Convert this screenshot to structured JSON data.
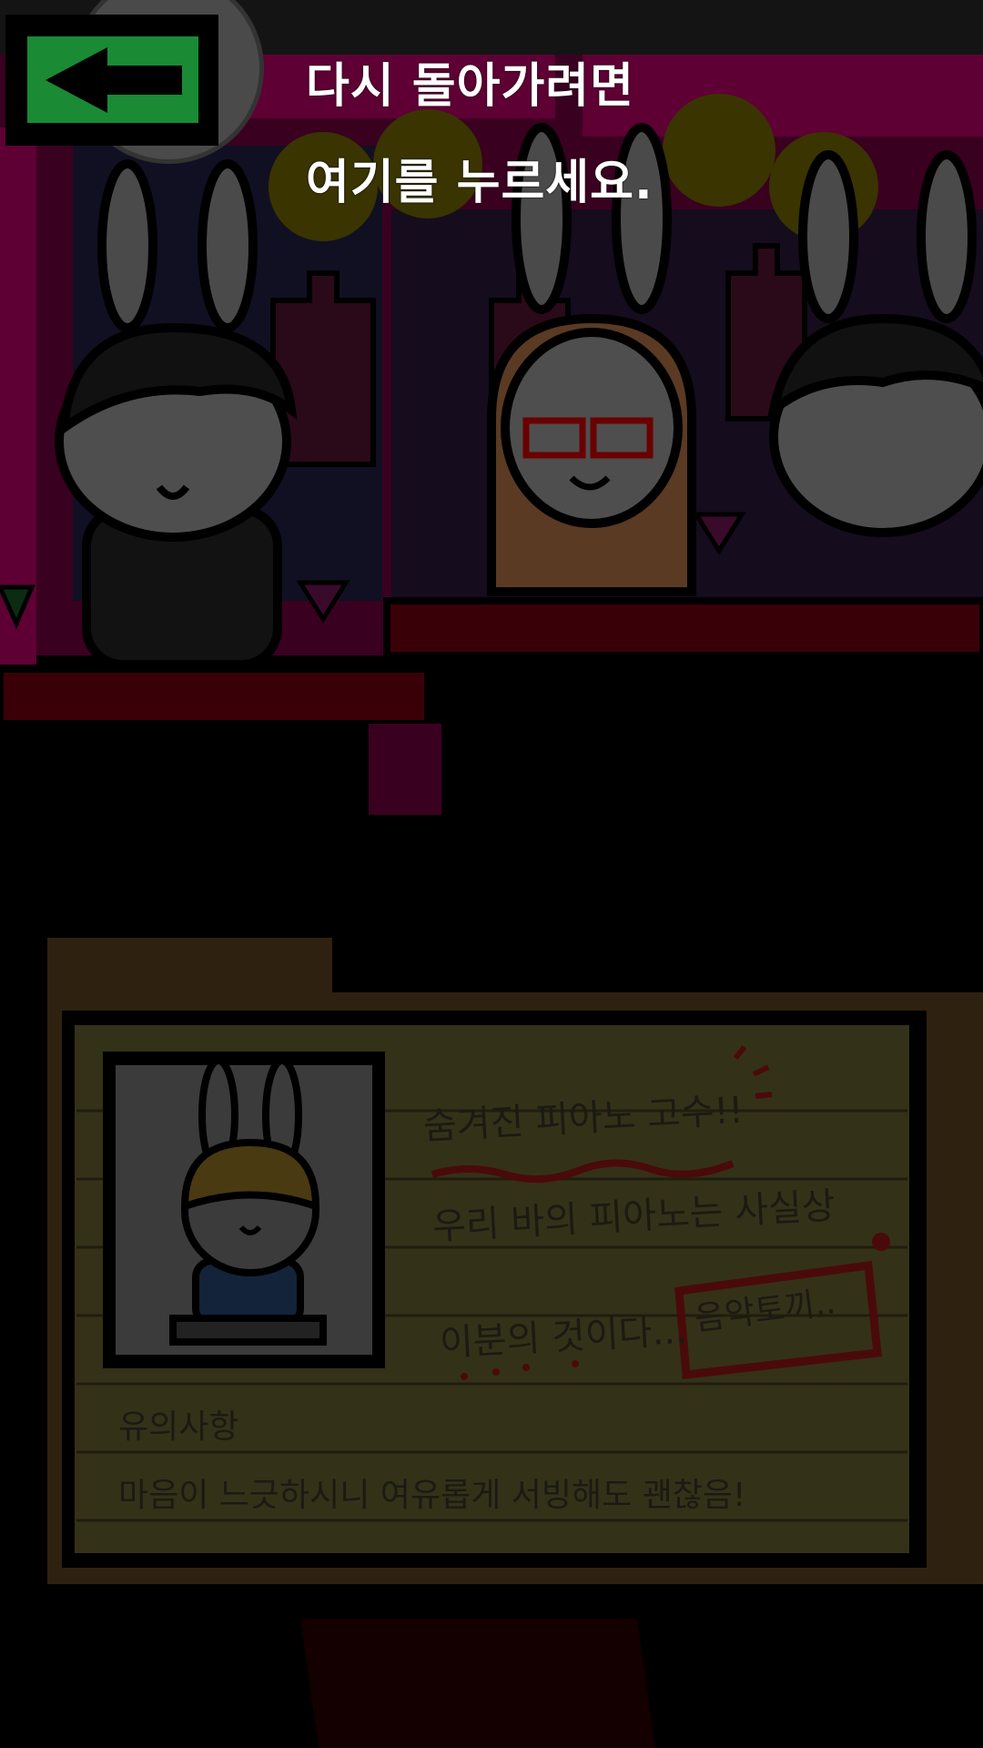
{
  "hint": {
    "line1": "다시 돌아가려면",
    "line2": "여기를 누르세요."
  },
  "back_button": {
    "icon": "arrow-left-icon",
    "color": "#1a8a34"
  },
  "card": {
    "title": "숨겨진 피아노 고수!!",
    "desc_line1": "우리 바의 피아노는 사실상",
    "desc_line2": "이분의 것이다...",
    "stamp": "음악토끼..",
    "note_label": "유의사항",
    "note_text": "마음이 느긋하시니 여유롭게 서빙해도 괜찮음!"
  }
}
